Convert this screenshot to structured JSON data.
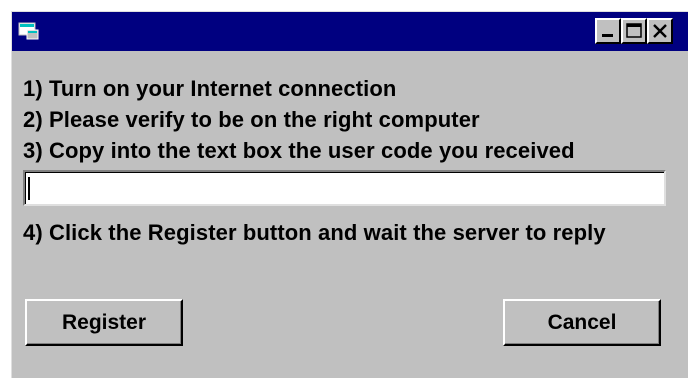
{
  "window": {
    "title": "",
    "titlebar_color": "#000080",
    "face_color": "#c0c0c0",
    "controls": {
      "minimize_icon": "minimize-icon",
      "maximize_icon": "maximize-icon",
      "close_icon": "close-icon"
    }
  },
  "instructions": [
    "1) Turn on your Internet connection",
    "2) Please verify to be on the right computer",
    "3) Copy into the text box the user code you received",
    "4) Click the Register button and wait the server to reply"
  ],
  "user_code": {
    "value": "",
    "placeholder": ""
  },
  "buttons": {
    "register_label": "Register",
    "cancel_label": "Cancel"
  }
}
